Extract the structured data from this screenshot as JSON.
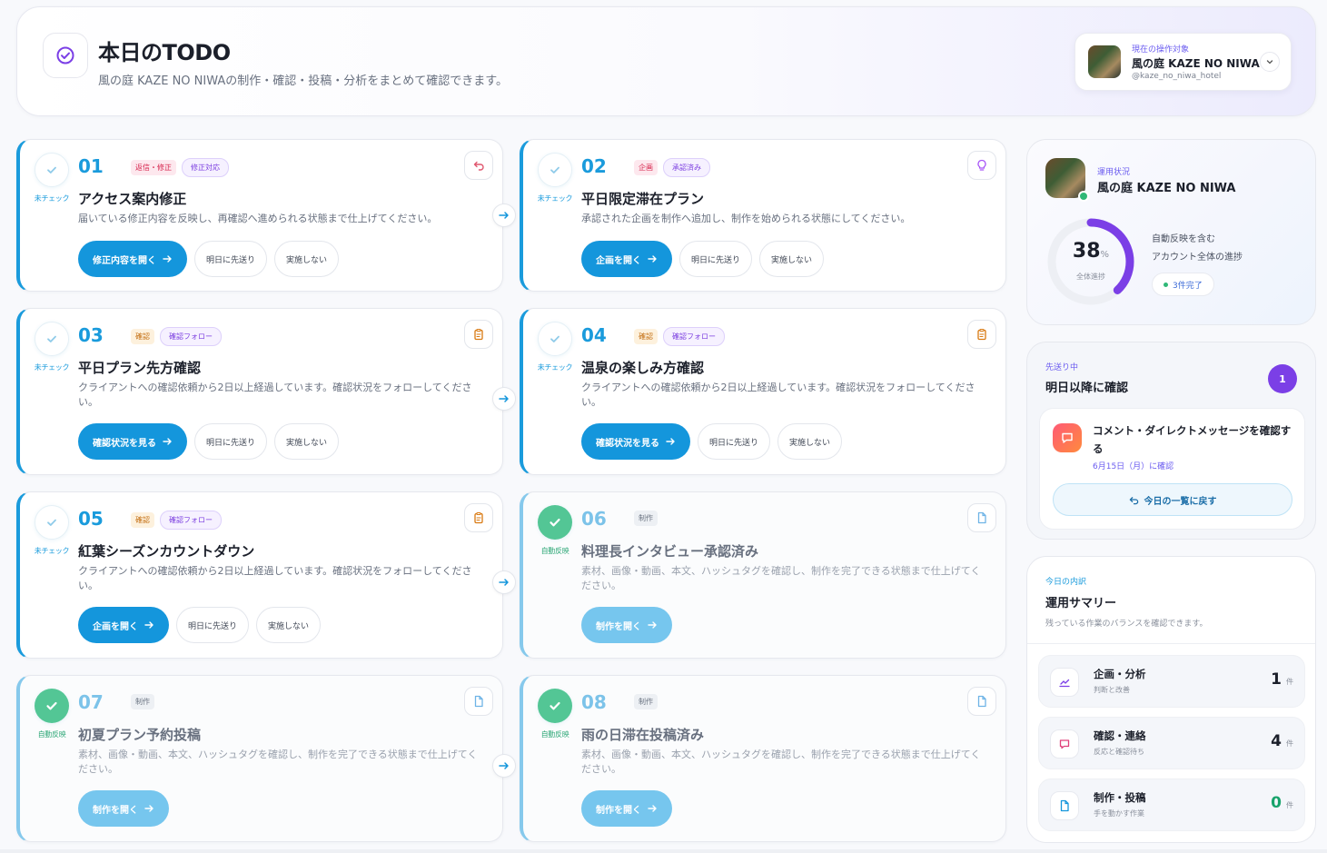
{
  "header": {
    "title": "本日のTODO",
    "subtitle": "風の庭 KAZE NO NIWAの制作・確認・投稿・分析をまとめて確認できます。"
  },
  "account": {
    "label": "現在の操作対象",
    "name": "風の庭 KAZE NO NIWA",
    "handle": "@kaze_no_niwa_hotel"
  },
  "tasks": [
    {
      "num": "01",
      "tags": [
        "返信・修正",
        "修正対応"
      ],
      "title": "アクセス案内修正",
      "desc": "届いている修正内容を反映し、再確認へ進められる状態まで仕上げてください。",
      "status": "未チェック",
      "primary": "修正内容を開く",
      "secondary": [
        "明日に先送り",
        "実施しない"
      ],
      "icon": "undo-icon"
    },
    {
      "num": "02",
      "tags": [
        "企画",
        "承認済み"
      ],
      "title": "平日限定滞在プラン",
      "desc": "承認された企画を制作へ追加し、制作を始められる状態にしてください。",
      "status": "未チェック",
      "primary": "企画を開く",
      "secondary": [
        "明日に先送り",
        "実施しない"
      ],
      "icon": "lightbulb-icon"
    },
    {
      "num": "03",
      "tags": [
        "確認",
        "確認フォロー"
      ],
      "title": "平日プラン先方確認",
      "desc": "クライアントへの確認依頼から2日以上経過しています。確認状況をフォローしてください。",
      "status": "未チェック",
      "primary": "確認状況を見る",
      "secondary": [
        "明日に先送り",
        "実施しない"
      ],
      "icon": "clipboard-icon"
    },
    {
      "num": "04",
      "tags": [
        "確認",
        "確認フォロー"
      ],
      "title": "温泉の楽しみ方確認",
      "desc": "クライアントへの確認依頼から2日以上経過しています。確認状況をフォローしてください。",
      "status": "未チェック",
      "primary": "確認状況を見る",
      "secondary": [
        "明日に先送り",
        "実施しない"
      ],
      "icon": "clipboard-icon"
    },
    {
      "num": "05",
      "tags": [
        "確認",
        "確認フォロー"
      ],
      "title": "紅葉シーズンカウントダウン",
      "desc": "クライアントへの確認依頼から2日以上経過しています。確認状況をフォローしてください。",
      "status": "未チェック",
      "primary": "企画を開く",
      "secondary": [
        "明日に先送り",
        "実施しない"
      ],
      "icon": "clipboard-icon"
    },
    {
      "num": "06",
      "tags": [
        "制作"
      ],
      "title": "料理長インタビュー承認済み",
      "desc": "素材、画像・動画、本文、ハッシュタグを確認し、制作を完了できる状態まで仕上げてください。",
      "status": "自動反映",
      "primary": "制作を開く",
      "secondary": [],
      "icon": "document-icon"
    },
    {
      "num": "07",
      "tags": [
        "制作"
      ],
      "title": "初夏プラン予約投稿",
      "desc": "素材、画像・動画、本文、ハッシュタグを確認し、制作を完了できる状態まで仕上げてください。",
      "status": "自動反映",
      "primary": "制作を開く",
      "secondary": [],
      "icon": "document-icon"
    },
    {
      "num": "08",
      "tags": [
        "制作"
      ],
      "title": "雨の日滞在投稿済み",
      "desc": "素材、画像・動画、本文、ハッシュタグを確認し、制作を完了できる状態まで仕上げてください。",
      "status": "自動反映",
      "primary": "制作を開く",
      "secondary": [],
      "icon": "document-icon"
    }
  ],
  "progress": {
    "label": "運用状況",
    "name": "風の庭 KAZE NO NIWA",
    "percent": "38",
    "percent_value": 38,
    "unit": "%",
    "ring_label": "全体進捗",
    "line1": "自動反映を含む",
    "line2": "アカウント全体の進捗",
    "done": "3件完了"
  },
  "postponed": {
    "label": "先送り中",
    "title": "明日以降に確認",
    "count": "1",
    "item_title": "コメント・ダイレクトメッセージを確認する",
    "item_date": "6月15日（月）に確認",
    "back_label": "今日の一覧に戻す"
  },
  "summary": {
    "label": "今日の内訳",
    "title": "運用サマリー",
    "subtitle": "残っている作業のバランスを確認できます。",
    "rows": [
      {
        "title": "企画・分析",
        "sub": "判断と改善",
        "count": "1",
        "unit": "件",
        "color": "#1b1f2a",
        "icon": "chart-icon"
      },
      {
        "title": "確認・連絡",
        "sub": "反応と確認待ち",
        "count": "4",
        "unit": "件",
        "color": "#1b1f2a",
        "icon": "chat-icon"
      },
      {
        "title": "制作・投稿",
        "sub": "手を動かす作業",
        "count": "0",
        "unit": "件",
        "color": "#18a36b",
        "icon": "document-icon"
      }
    ]
  },
  "colors": {
    "accent": "#1496dc",
    "purple": "#7b3fe6",
    "green": "#53c695"
  }
}
